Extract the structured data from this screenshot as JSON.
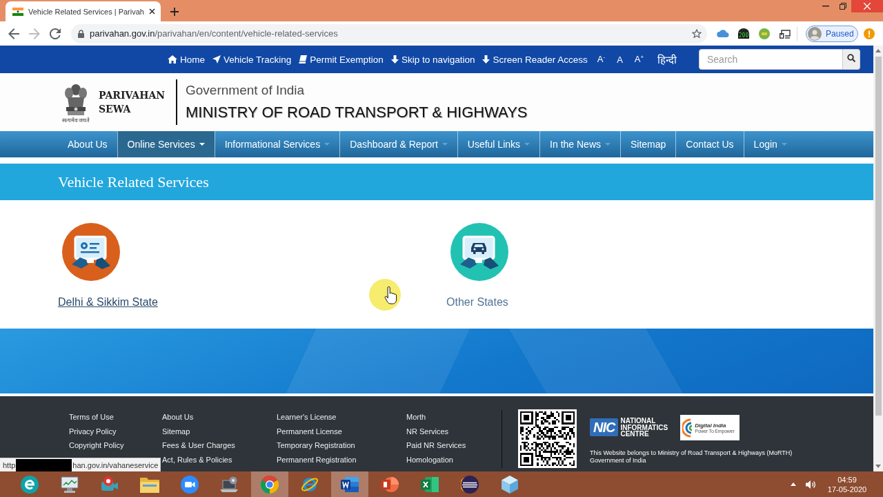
{
  "browser": {
    "tab": {
      "title": "Vehicle Related Services | Parivah",
      "selected": true
    },
    "nav_buttons": [
      {
        "kind": "back",
        "disabled": false
      },
      {
        "kind": "forward",
        "disabled": true
      },
      {
        "kind": "reload",
        "disabled": false
      }
    ],
    "url": {
      "host": "parivahan.gov.in",
      "path": "/parivahan/en/content/vehicle-related-services"
    },
    "extension_badge": "200",
    "profile": {
      "label": "Paused"
    }
  },
  "site": {
    "top_bar": {
      "links": [
        {
          "kind": "home",
          "label": "Home"
        },
        {
          "kind": "send",
          "label": "Vehicle Tracking"
        },
        {
          "kind": "book",
          "label": "Permit Exemption"
        },
        {
          "kind": "arrow",
          "label": "Skip to navigation"
        },
        {
          "kind": "arrow",
          "label": "Screen Reader Access"
        }
      ],
      "font_size_controls": [
        "A$^{-}$",
        "A",
        "A$^{+}$"
      ],
      "language": "हिन्दी",
      "search": {
        "placeholder": "Search"
      }
    },
    "header": {
      "emblem_motto": "सत्यमेव जयते",
      "brand": [
        "PARIVAHAN",
        "SEWA"
      ],
      "government": "Government of India",
      "ministry": "MINISTRY OF ROAD TRANSPORT & HIGHWAYS"
    },
    "nav": [
      {
        "label": "About Us",
        "dropdown": false,
        "selected": false
      },
      {
        "label": "Online Services",
        "dropdown": true,
        "selected": true
      },
      {
        "label": "Informational Services",
        "dropdown": true,
        "selected": false
      },
      {
        "label": "Dashboard & Report",
        "dropdown": true,
        "selected": false
      },
      {
        "label": "Useful Links",
        "dropdown": true,
        "selected": false
      },
      {
        "label": "In the News",
        "dropdown": true,
        "selected": false
      },
      {
        "label": "Sitemap",
        "dropdown": false,
        "selected": false
      },
      {
        "label": "Contact Us",
        "dropdown": false,
        "selected": false
      },
      {
        "label": "Login",
        "dropdown": true,
        "selected": false
      }
    ],
    "page_title": "Vehicle Related Services",
    "services": [
      {
        "label": "Delhi & Sikkim State",
        "kind": "document",
        "color": "#d9601c",
        "highlighted": true
      },
      {
        "label": "Other States",
        "kind": "car",
        "color": "#22c2b3",
        "highlighted": false
      }
    ],
    "footer": {
      "columns": [
        [
          "Terms of Use",
          "Privacy Policy",
          "Copyright Policy"
        ],
        [
          "About Us",
          "Sitemap",
          "Fees & User Charges",
          "Act, Rules & Policies"
        ],
        [
          "Learner's License",
          "Permanent License",
          "Temporary Registration",
          "Permanent Registration"
        ],
        [
          "Morth",
          "NR Services",
          "Paid NR Services",
          "Homologation"
        ]
      ],
      "nic_logo": {
        "mark": "NIC",
        "name": [
          "NATIONAL",
          "INFORMATICS",
          "CENTRE"
        ]
      },
      "digital_india_logo": {
        "name": "Digital India",
        "tagline": "Power To Empower"
      },
      "ownership": [
        "This Website belongs to Ministry of Road Transport & Highways (MoRTH)",
        "Government of India"
      ]
    },
    "status_bubble": {
      "start": "http",
      "end": "han.gov.in/vahaneservice"
    }
  },
  "taskbar": {
    "apps": [
      {
        "kind": "eset",
        "active": false
      },
      {
        "kind": "monitor",
        "active": false
      },
      {
        "kind": "recorder",
        "active": false
      },
      {
        "kind": "folder",
        "active": false
      },
      {
        "kind": "zoom",
        "active": false
      },
      {
        "kind": "laptop",
        "active": false
      },
      {
        "kind": "chrome",
        "active": true
      },
      {
        "kind": "ie",
        "active": false
      },
      {
        "kind": "word",
        "active": true
      },
      {
        "kind": "powerpoint",
        "active": false
      },
      {
        "kind": "excel",
        "active": false
      },
      {
        "kind": "eclipse",
        "active": false
      },
      {
        "kind": "cube",
        "active": false
      }
    ],
    "clock": {
      "time": "04:59",
      "date": "17-05-2020"
    }
  }
}
